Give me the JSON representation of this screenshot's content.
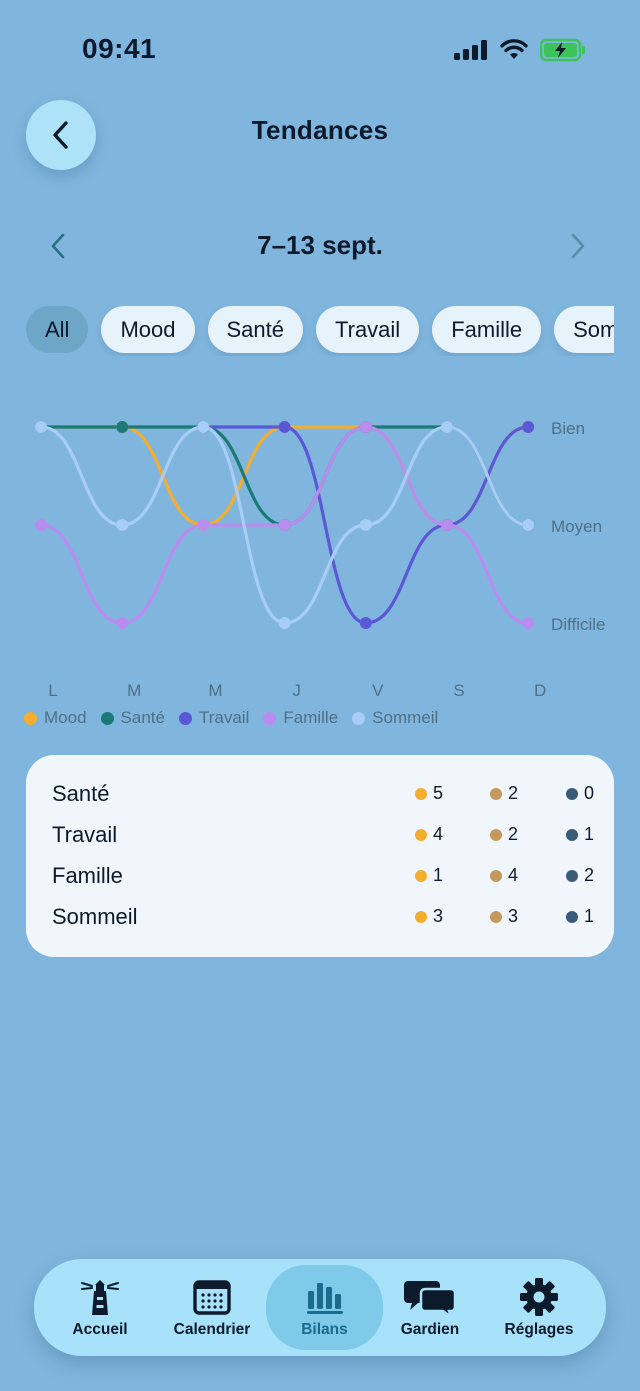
{
  "status": {
    "time": "09:41"
  },
  "header": {
    "title": "Tendances"
  },
  "week": {
    "label": "7–13 sept."
  },
  "filters": [
    "All",
    "Mood",
    "Santé",
    "Travail",
    "Famille",
    "Sommeil"
  ],
  "chart_data": {
    "type": "line",
    "x": [
      "L",
      "M",
      "M",
      "J",
      "V",
      "S",
      "D"
    ],
    "y_levels": [
      "Difficile",
      "Moyen",
      "Bien"
    ],
    "series": [
      {
        "name": "Mood",
        "color": "#f3ad2f",
        "values": [
          3,
          3,
          2,
          3,
          3,
          2,
          3
        ]
      },
      {
        "name": "Santé",
        "color": "#1b7a78",
        "values": [
          3,
          3,
          3,
          2,
          3,
          3,
          2
        ]
      },
      {
        "name": "Travail",
        "color": "#5a58d6",
        "values": [
          null,
          null,
          3,
          3,
          1,
          2,
          3
        ]
      },
      {
        "name": "Famille",
        "color": "#b98cf0",
        "values": [
          2,
          1,
          2,
          2,
          3,
          2,
          1
        ]
      },
      {
        "name": "Sommeil",
        "color": "#a8cdf6",
        "values": [
          3,
          2,
          3,
          1,
          2,
          3,
          2
        ]
      }
    ]
  },
  "summary": {
    "level_colors": [
      "#f3ad2f",
      "#c49a5c",
      "#3a5a78"
    ],
    "rows": [
      {
        "category": "Santé",
        "counts": [
          "5",
          "2",
          "0"
        ]
      },
      {
        "category": "Travail",
        "counts": [
          "4",
          "2",
          "1"
        ]
      },
      {
        "category": "Famille",
        "counts": [
          "1",
          "4",
          "2"
        ]
      },
      {
        "category": "Sommeil",
        "counts": [
          "3",
          "3",
          "1"
        ]
      }
    ]
  },
  "tabs": [
    {
      "label": "Accueil",
      "icon": "lighthouse-icon"
    },
    {
      "label": "Calendrier",
      "icon": "calendar-icon"
    },
    {
      "label": "Bilans",
      "icon": "bar-chart-icon"
    },
    {
      "label": "Gardien",
      "icon": "chat-bubbles-icon"
    },
    {
      "label": "Réglages",
      "icon": "gear-icon"
    }
  ]
}
